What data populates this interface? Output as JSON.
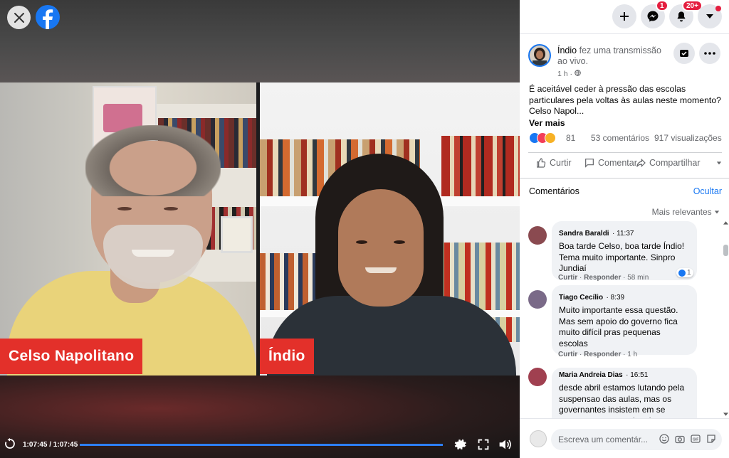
{
  "video": {
    "left_name": "Celso Napolitano",
    "right_name": "Índio",
    "time": "1:07:45 / 1:07:45",
    "progress": 1.0
  },
  "topbar": {
    "messenger_badge": "1",
    "notifications_badge": "20+"
  },
  "post": {
    "author": "Índio",
    "action_text": "fez uma transmissão ao vivo.",
    "time": "1 h",
    "text": "É aceitável ceder à pressão das escolas particulares pela voltas às aulas neste momento? Celso Napol...",
    "see_more": "Ver mais",
    "reactions_count": "81",
    "comments_count": "53 comentários",
    "views_count": "917 visualizações",
    "actions": {
      "like": "Curtir",
      "comment": "Comentar",
      "share": "Compartilhar"
    }
  },
  "comments_section": {
    "title": "Comentários",
    "hide": "Ocultar",
    "sort": "Mais relevantes",
    "items": [
      {
        "name": "Sandra Baraldi",
        "time": "11:37",
        "text": "Boa tarde Celso, boa tarde Índio! Tema muito importante. Sinpro Jundiaí",
        "like": "Curtir",
        "reply": "Responder",
        "age": "58 min",
        "likes": "1"
      },
      {
        "name": "Tiago Cecílio",
        "time": "8:39",
        "text": "Muito importante essa questão. Mas sem apoio do governo fica muito difícil pras pequenas escolas",
        "like": "Curtir",
        "reply": "Responder",
        "age": "1 h"
      },
      {
        "name": "Maria Andreia Dias",
        "time": "16:51",
        "text": "desde abril estamos lutando pela suspensao das aulas, mas os governantes insistem em se curvar ao empresarios da"
      }
    ],
    "write_placeholder": "Escreva um comentár..."
  },
  "colors": {
    "accent": "#1877f2",
    "badge": "#e41e3f",
    "name_tag": "#e3302a"
  }
}
